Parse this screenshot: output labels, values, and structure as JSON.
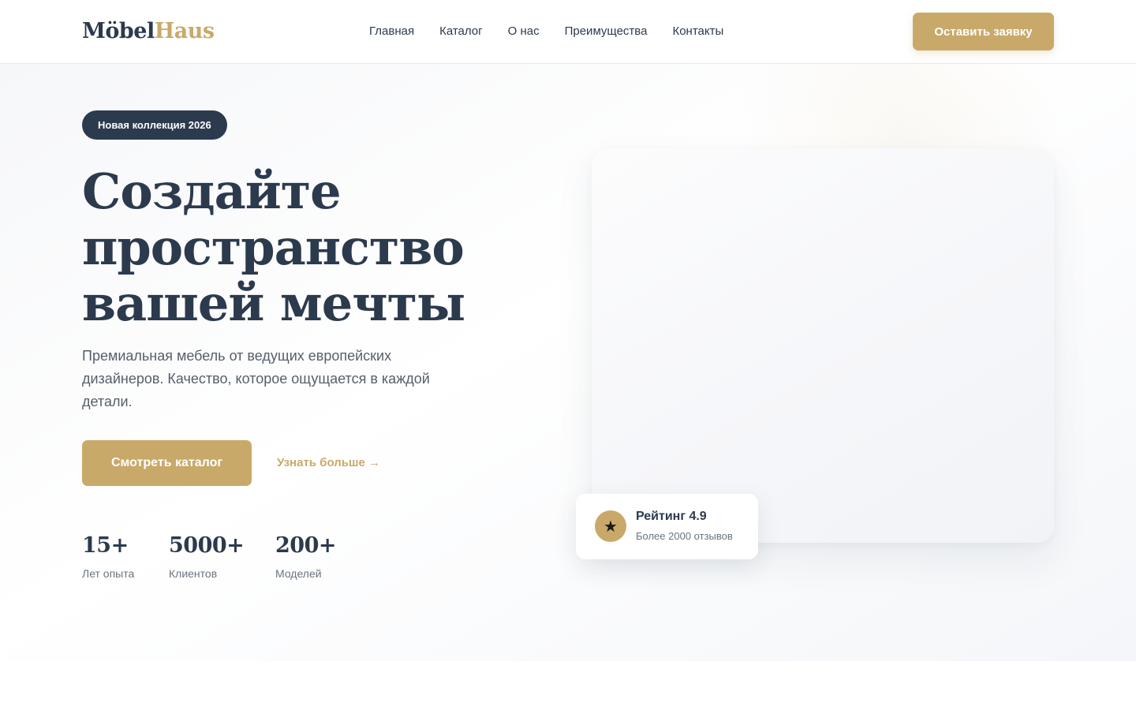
{
  "header": {
    "logo_part1": "Möbel",
    "logo_part2": "Haus",
    "nav": [
      "Главная",
      "Каталог",
      "О нас",
      "Преимущества",
      "Контакты"
    ],
    "cta_label": "Оставить заявку"
  },
  "hero": {
    "badge": "Новая коллекция 2026",
    "headline": "Создайте пространство вашей мечты",
    "lead": "Премиальная мебель от ведущих европейских дизайнеров. Качество, которое ощущается в каждой детали.",
    "primary_button": "Смотреть каталог",
    "secondary_link": "Узнать больше →",
    "stats": [
      {
        "value": "15+",
        "label": "Лет опыта"
      },
      {
        "value": "5000+",
        "label": "Клиентов"
      },
      {
        "value": "200+",
        "label": "Моделей"
      }
    ],
    "rating": {
      "icon": "star-icon",
      "title": "Рейтинг 4.9",
      "subtitle": "Более 2000 отзывов"
    }
  },
  "colors": {
    "accent": "#c9a96a",
    "dark": "#2c3a4d"
  }
}
